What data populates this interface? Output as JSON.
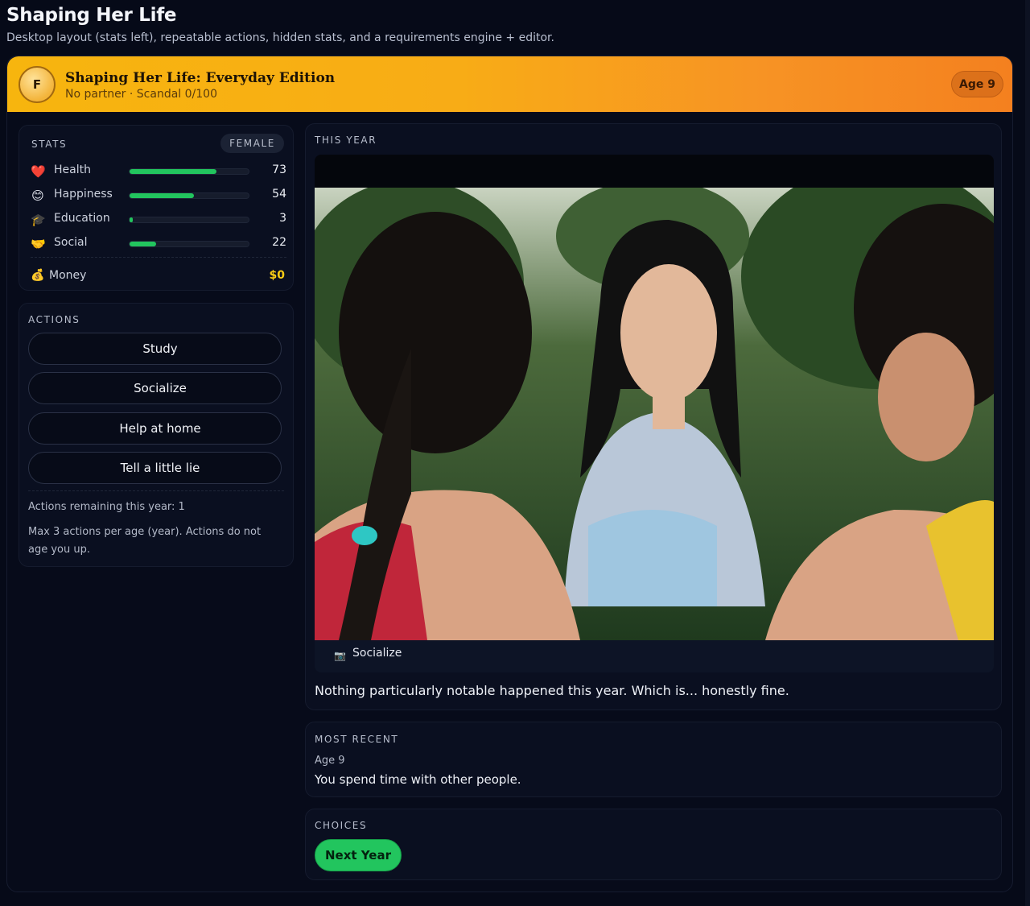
{
  "app": {
    "title": "Shaping Her Life",
    "subtitle": "Desktop layout (stats left), repeatable actions, hidden stats, and a requirements engine + editor."
  },
  "banner": {
    "avatar_letter": "F",
    "title": "Shaping Her Life: Everyday Edition",
    "subtitle": "No partner · Scandal 0/100",
    "age": "Age 9",
    "gradient_colors": [
      "#f7b50e",
      "#f4801f"
    ]
  },
  "stats": {
    "label": "STATS",
    "sex": "FEMALE",
    "items": [
      {
        "name": "Health",
        "value": "73",
        "fraction": 0.73,
        "icon": "heart-icon",
        "glyph": "❤️"
      },
      {
        "name": "Happiness",
        "value": "54",
        "fraction": 0.54,
        "icon": "smile-icon",
        "glyph": "😊"
      },
      {
        "name": "Education",
        "value": "3",
        "fraction": 0.03,
        "icon": "graduation-cap-icon",
        "glyph": "🎓"
      },
      {
        "name": "Social",
        "value": "22",
        "fraction": 0.22,
        "icon": "handshake-icon",
        "glyph": "🤝"
      }
    ],
    "money_label": "Money",
    "money_value": "$0",
    "money_icon": "money-bag-icon",
    "money_glyph": "💰",
    "bar_color": "#22c55e",
    "money_color": "#facc15"
  },
  "actions": {
    "label": "ACTIONS",
    "buttons": [
      "Study",
      "Socialize",
      "Help at home",
      "Tell a little lie"
    ],
    "remaining": "Actions remaining this year: 1",
    "note": "Max 3 actions per age (year). Actions do not age you up."
  },
  "this_year": {
    "label": "THIS YEAR",
    "image_alt": "",
    "caption_icon": "photo-icon",
    "caption": "Socialize",
    "text": "Nothing particularly notable happened this year. Which is... honestly fine."
  },
  "recent": {
    "label": "MOST RECENT",
    "age": "Age 9",
    "text": "You spend time with other people."
  },
  "choices": {
    "label": "CHOICES",
    "next": "Next Year",
    "next_color": "#22c55e"
  }
}
